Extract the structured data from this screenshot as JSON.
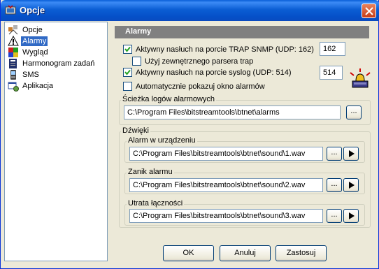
{
  "window": {
    "title": "Opcje"
  },
  "tree": {
    "items": [
      {
        "label": "Opcje",
        "icon": "options-icon",
        "selected": false
      },
      {
        "label": "Alarmy",
        "icon": "alarm-icon",
        "selected": true
      },
      {
        "label": "Wygląd",
        "icon": "appearance-icon",
        "selected": false
      },
      {
        "label": "Harmonogram zadań",
        "icon": "schedule-icon",
        "selected": false
      },
      {
        "label": "SMS",
        "icon": "sms-icon",
        "selected": false
      },
      {
        "label": "Aplikacja",
        "icon": "application-icon",
        "selected": false
      }
    ]
  },
  "alarms": {
    "header": "Alarmy",
    "trap_snmp": {
      "label": "Aktywny nasłuch na porcie TRAP SNMP (UDP: 162)",
      "checked": true,
      "port": "162"
    },
    "external_parser": {
      "label": "Użyj zewnętrznego parsera trap",
      "checked": false
    },
    "syslog": {
      "label": "Aktywny nasłuch na porcie syslog (UDP: 514)",
      "checked": true,
      "port": "514"
    },
    "auto_show": {
      "label": "Automatycznie pokazuj okno alarmów",
      "checked": false
    },
    "log_path": {
      "title": "Ścieżka logów alarmowych",
      "value": "C:\\Program Files\\bitstreamtools\\btnet\\alarms",
      "browse": "..."
    },
    "sounds": {
      "title": "Dźwięki",
      "device_alarm": {
        "title": "Alarm w urządzeniu",
        "value": "C:\\Program Files\\bitstreamtools\\btnet\\sound\\1.wav",
        "browse": "..."
      },
      "alarm_clear": {
        "title": "Zanik alarmu",
        "value": "C:\\Program Files\\bitstreamtools\\btnet\\sound\\2.wav",
        "browse": "..."
      },
      "connection_loss": {
        "title": "Utrata łączności",
        "value": "C:\\Program Files\\bitstreamtools\\btnet\\sound\\3.wav",
        "browse": "..."
      }
    }
  },
  "buttons": {
    "ok": "OK",
    "cancel": "Anuluj",
    "apply": "Zastosuj"
  },
  "colors": {
    "titlebar": "#0a5fd8",
    "selection": "#316ac5",
    "header": "#808080",
    "face": "#ece9d8"
  }
}
